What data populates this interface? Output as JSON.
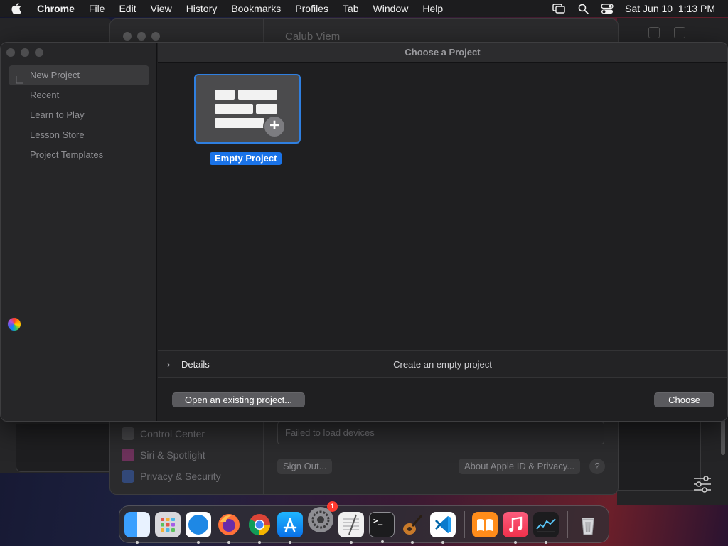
{
  "menubar": {
    "apple_icon": "apple-icon",
    "app_name": "Chrome",
    "items": [
      "File",
      "Edit",
      "View",
      "History",
      "Bookmarks",
      "Profiles",
      "Tab",
      "Window",
      "Help"
    ],
    "status_icons": [
      "screen-mirroring-icon",
      "search-icon",
      "control-center-icon"
    ],
    "clock": "Sat Jun 10  1:13 PM"
  },
  "background": {
    "chrome_window_title": "Calub Viem",
    "settings_rows": [
      {
        "label": "Control Center",
        "color": "#5c5c60"
      },
      {
        "label": "Siri & Spotlight",
        "color": "#b03a8a"
      },
      {
        "label": "Privacy & Security",
        "color": "#3a66c4"
      }
    ],
    "devices_status": "Failed to load devices",
    "sign_out_label": "Sign Out...",
    "about_label": "About Apple ID & Privacy...",
    "help_label": "?"
  },
  "dialog": {
    "title": "Choose a Project",
    "sidebar": [
      {
        "label": "New Project",
        "selected": true
      },
      {
        "label": "Recent",
        "selected": false
      },
      {
        "label": "Learn to Play",
        "selected": false
      },
      {
        "label": "Lesson Store",
        "selected": false
      },
      {
        "label": "Project Templates",
        "selected": false
      }
    ],
    "template": {
      "label": "Empty Project",
      "selected": true
    },
    "details": {
      "chevron": "›",
      "label": "Details",
      "description": "Create an empty project"
    },
    "footer": {
      "open_label": "Open an existing project...",
      "choose_label": "Choose"
    }
  },
  "dock": {
    "apps": [
      {
        "name": "Finder",
        "icon": "finder-icon",
        "color": "#2d8cf0",
        "running": true
      },
      {
        "name": "Launchpad",
        "icon": "launchpad-icon",
        "color": "#d8d8dc",
        "running": false
      },
      {
        "name": "Safari",
        "icon": "safari-icon",
        "color": "#1e88e5",
        "running": true
      },
      {
        "name": "Firefox",
        "icon": "firefox-icon",
        "color": "#ff7139",
        "running": true
      },
      {
        "name": "Chrome",
        "icon": "chrome-icon",
        "color": "#ffffff",
        "running": true
      },
      {
        "name": "App Store",
        "icon": "app-store-icon",
        "color": "#1a8cff",
        "running": true
      },
      {
        "name": "System Settings",
        "icon": "system-settings-icon",
        "color": "#8e8e93",
        "running": true,
        "badge": "1"
      },
      {
        "name": "TextEdit",
        "icon": "textedit-icon",
        "color": "#f0f0f0",
        "running": true
      },
      {
        "name": "Terminal",
        "icon": "terminal-icon",
        "color": "#1c1c1e",
        "running": true
      },
      {
        "name": "GarageBand",
        "icon": "garageband-icon",
        "color": "#3a2a1e",
        "running": true
      },
      {
        "name": "Visual Studio Code",
        "icon": "vscode-icon",
        "color": "#ffffff",
        "running": true
      }
    ],
    "extras": [
      {
        "name": "Books",
        "icon": "books-icon",
        "color": "#ff8c1a",
        "running": false
      },
      {
        "name": "Music",
        "icon": "music-icon",
        "color": "#fa3b55",
        "running": true
      },
      {
        "name": "Stocks",
        "icon": "stocks-icon",
        "color": "#1c1c1e",
        "running": true
      }
    ],
    "trash": {
      "name": "Trash",
      "icon": "trash-icon"
    }
  }
}
